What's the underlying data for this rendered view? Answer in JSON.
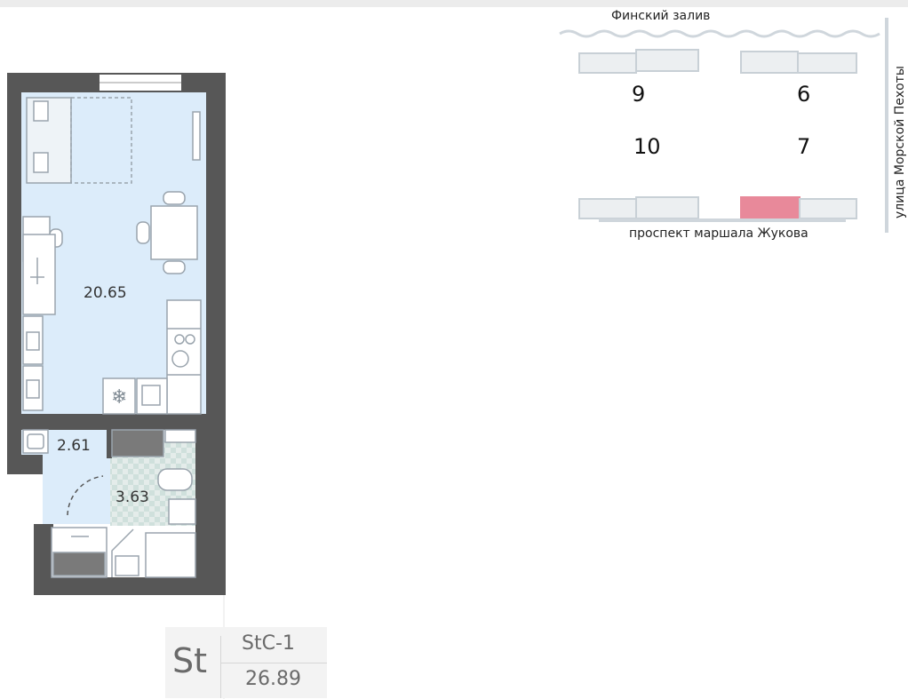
{
  "plan": {
    "rooms": [
      {
        "id": "living",
        "area": "20.65"
      },
      {
        "id": "hall",
        "area": "2.61"
      },
      {
        "id": "bath",
        "area": "3.63"
      }
    ]
  },
  "site_map": {
    "water_label": "Финский залив",
    "street_bottom": "проспект маршала Жукова",
    "street_right": "улица Морской Пехоты",
    "buildings": [
      {
        "number": "9",
        "highlighted": false
      },
      {
        "number": "6",
        "highlighted": false
      },
      {
        "number": "10",
        "highlighted": false
      },
      {
        "number": "7",
        "highlighted": true
      }
    ],
    "highlight_color": "#e8899a"
  },
  "unit": {
    "type": "St",
    "code": "StC-1",
    "total_area": "26.89"
  },
  "colors": {
    "wall": "#555555",
    "floor": "#dcecfa",
    "tile": "#dfe8e6"
  }
}
